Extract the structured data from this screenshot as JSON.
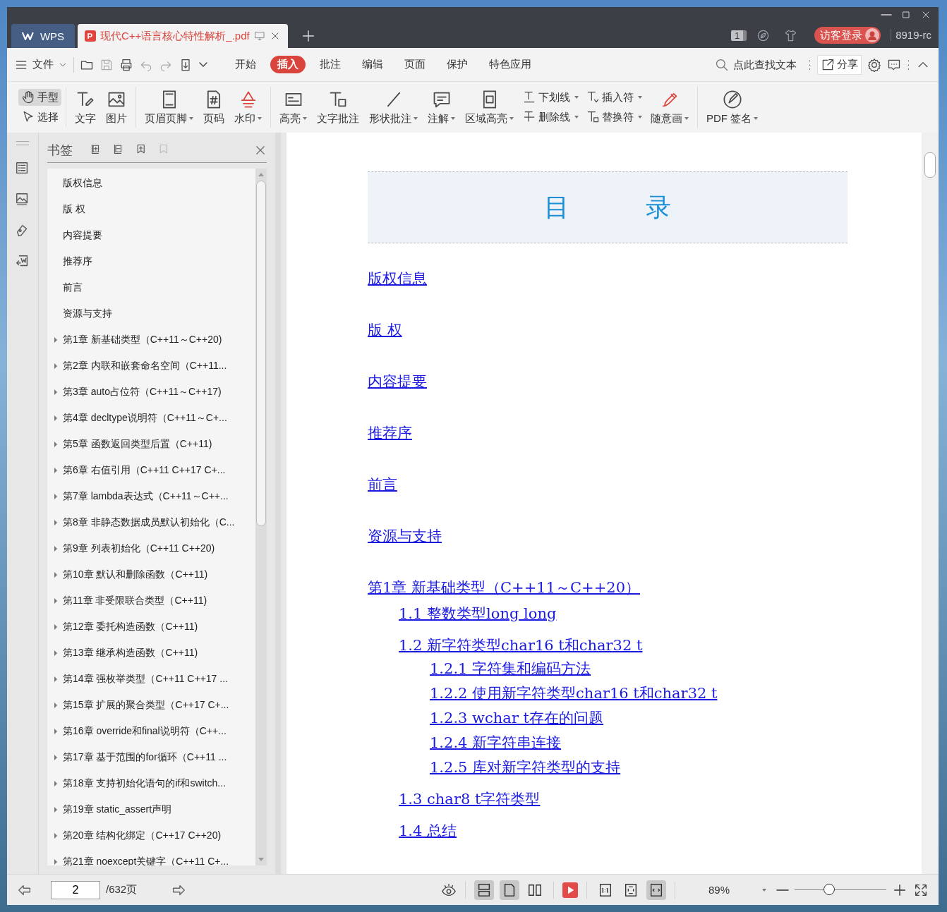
{
  "tabs": [
    {
      "kind": "home",
      "label": "WPS",
      "selected": false
    },
    {
      "kind": "document",
      "label": "现代C++语言核心特性解析_.pdf",
      "selected": true
    }
  ],
  "title_bar": {
    "badge": "1",
    "login": "访客登录",
    "user": "8919-rc"
  },
  "menu": {
    "file": "文件",
    "tabs": [
      {
        "label": "开始",
        "selected": false
      },
      {
        "label": "插入",
        "selected": true
      },
      {
        "label": "批注",
        "selected": false
      },
      {
        "label": "编辑",
        "selected": false
      },
      {
        "label": "页面",
        "selected": false
      },
      {
        "label": "保护",
        "selected": false
      },
      {
        "label": "特色应用",
        "selected": false
      }
    ],
    "search": {
      "placeholder": "点此查找文本"
    },
    "share": "分享"
  },
  "toolbar": {
    "groups": [
      [
        {
          "kind": "stack",
          "items": [
            {
              "label": "手型",
              "has_menu": false,
              "selected": true
            },
            {
              "label": "选择",
              "has_menu": false,
              "selected": false
            }
          ]
        }
      ],
      [
        {
          "kind": "big",
          "label": "文字",
          "has_menu": false,
          "selected": false
        },
        {
          "kind": "big",
          "label": "图片",
          "has_menu": false,
          "selected": false
        }
      ],
      [
        {
          "kind": "big",
          "label": "页眉页脚",
          "has_menu": true,
          "selected": false
        },
        {
          "kind": "big",
          "label": "页码",
          "has_menu": false,
          "selected": false
        },
        {
          "kind": "big",
          "label": "水印",
          "has_menu": true,
          "selected": false
        }
      ],
      [
        {
          "kind": "big",
          "label": "高亮",
          "has_menu": true,
          "selected": false
        },
        {
          "kind": "big",
          "label": "文字批注",
          "has_menu": false,
          "selected": false
        },
        {
          "kind": "big",
          "label": "形状批注",
          "has_menu": true,
          "selected": false
        },
        {
          "kind": "big",
          "label": "注解",
          "has_menu": true,
          "selected": false
        },
        {
          "kind": "big",
          "label": "区域高亮",
          "has_menu": true,
          "selected": false
        },
        {
          "kind": "stack",
          "items": [
            {
              "label": "下划线",
              "has_menu": true,
              "selected": false
            },
            {
              "label": "删除线",
              "has_menu": true,
              "selected": false
            }
          ]
        },
        {
          "kind": "stack",
          "items": [
            {
              "label": "插入符",
              "has_menu": true,
              "selected": false
            },
            {
              "label": "替换符",
              "has_menu": true,
              "selected": false
            }
          ]
        },
        {
          "kind": "big",
          "label": "随意画",
          "has_menu": true,
          "selected": false
        }
      ],
      [
        {
          "kind": "big",
          "label": "PDF 签名",
          "has_menu": true,
          "selected": false
        }
      ]
    ]
  },
  "bookmarks": {
    "title": "书签",
    "items": [
      {
        "label": "版权信息",
        "expandable": false
      },
      {
        "label": "版 权",
        "expandable": false
      },
      {
        "label": "内容提要",
        "expandable": false
      },
      {
        "label": "推荐序",
        "expandable": false
      },
      {
        "label": "前言",
        "expandable": false
      },
      {
        "label": "资源与支持",
        "expandable": false
      },
      {
        "label": "第1章 新基础类型（C++11～C++20)",
        "expandable": true
      },
      {
        "label": "第2章 内联和嵌套命名空间（C++11...",
        "expandable": true
      },
      {
        "label": "第3章 auto占位符（C++11～C++17)",
        "expandable": true
      },
      {
        "label": "第4章 decltype说明符（C++11～C+...",
        "expandable": true
      },
      {
        "label": "第5章 函数返回类型后置（C++11)",
        "expandable": true
      },
      {
        "label": "第6章 右值引用（C++11 C++17 C+...",
        "expandable": true
      },
      {
        "label": "第7章 lambda表达式（C++11～C++...",
        "expandable": true
      },
      {
        "label": "第8章 非静态数据成员默认初始化（C...",
        "expandable": true
      },
      {
        "label": "第9章 列表初始化（C++11 C++20)",
        "expandable": true
      },
      {
        "label": "第10章 默认和删除函数（C++11)",
        "expandable": true
      },
      {
        "label": "第11章 非受限联合类型（C++11)",
        "expandable": true
      },
      {
        "label": "第12章 委托构造函数（C++11)",
        "expandable": true
      },
      {
        "label": "第13章 继承构造函数（C++11)",
        "expandable": true
      },
      {
        "label": "第14章 强枚举类型（C++11 C++17 ...",
        "expandable": true
      },
      {
        "label": "第15章 扩展的聚合类型（C++17 C+...",
        "expandable": true
      },
      {
        "label": "第16章 override和final说明符（C++...",
        "expandable": true
      },
      {
        "label": "第17章 基于范围的for循环（C++11 ...",
        "expandable": true
      },
      {
        "label": "第18章 支持初始化语句的if和switch...",
        "expandable": true
      },
      {
        "label": "第19章 static_assert声明",
        "expandable": true
      },
      {
        "label": "第20章 结构化绑定（C++17 C++20)",
        "expandable": true
      },
      {
        "label": "第21章 noexcept关键字（C++11 C+...",
        "expandable": true
      }
    ]
  },
  "document": {
    "toc_title": "目　　　录",
    "toc": [
      {
        "label": "版权信息"
      },
      {
        "label": "版 权"
      },
      {
        "label": "内容提要"
      },
      {
        "label": "推荐序"
      },
      {
        "label": "前言"
      },
      {
        "label": "资源与支持"
      },
      {
        "label": "第1章  新基础类型（C++11～C++20）",
        "children": [
          {
            "label": "1.1  整数类型long long"
          },
          {
            "label": "1.2  新字符类型char16 t和char32 t",
            "children": [
              {
                "label": "1.2.1  字符集和编码方法"
              },
              {
                "label": "1.2.2  使用新字符类型char16 t和char32 t"
              },
              {
                "label": "1.2.3  wchar t存在的问题"
              },
              {
                "label": "1.2.4  新字符串连接"
              },
              {
                "label": "1.2.5  库对新字符类型的支持"
              }
            ]
          },
          {
            "label": "1.3  char8 t字符类型"
          },
          {
            "label": "1.4  总结"
          }
        ]
      }
    ]
  },
  "status_bar": {
    "page": "2",
    "total": "/632页",
    "view_modes": [
      {
        "selected": true
      },
      {
        "selected": true
      },
      {
        "selected": false
      }
    ],
    "fit_modes": [
      {
        "selected": false
      },
      {
        "selected": false
      },
      {
        "selected": true
      }
    ],
    "zoom": "89%",
    "zoom_slider": {
      "level": 0.38
    }
  }
}
